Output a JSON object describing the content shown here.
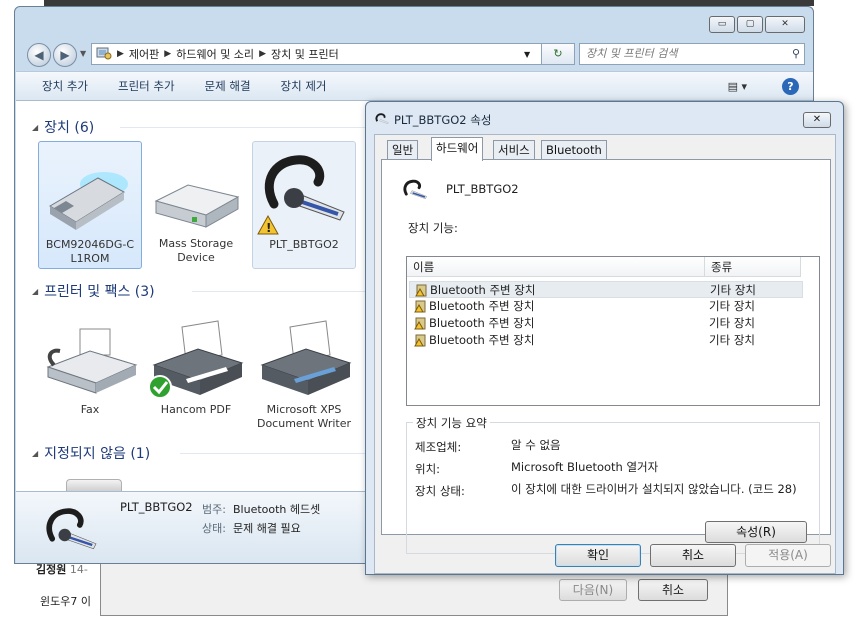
{
  "background_window": {
    "next_label": "다음(N)",
    "cancel_label": "취소",
    "text_partial_1": "김정원",
    "text_partial_1b": "14-",
    "text_partial_2": "윈도우7 이"
  },
  "explorer": {
    "window_buttons": {
      "minimize": "▭",
      "maximize": "▢",
      "close": "✕"
    },
    "breadcrumb": [
      "제어판",
      "하드웨어 및 소리",
      "장치 및 프린터"
    ],
    "search_placeholder": "장치 및 프린터 검색",
    "command_bar": [
      "장치 추가",
      "프린터 추가",
      "문제 해결",
      "장치 제거"
    ],
    "help_label": "?",
    "groups": {
      "devices": "장치 (6)",
      "printers": "프린터 및 팩스 (3)",
      "unspecified": "지정되지 않음 (1)"
    },
    "devices": [
      {
        "label": "BCM92046DG-C\nL1ROM",
        "icon": "usb-dongle-icon"
      },
      {
        "label": "Mass Storage\nDevice",
        "icon": "storage-drive-icon"
      },
      {
        "label": "PLT_BBTGO2",
        "icon": "headset-icon",
        "warning": true
      }
    ],
    "printers": [
      {
        "label": "Fax",
        "icon": "fax-icon"
      },
      {
        "label": "Hancom PDF",
        "icon": "printer-icon",
        "default": true
      },
      {
        "label": "Microsoft XPS\nDocument Writer",
        "icon": "printer-icon"
      }
    ],
    "details": {
      "name": "PLT_BBTGO2",
      "category_label": "범주:",
      "category_value": "Bluetooth 헤드셋",
      "status_label": "상태:",
      "status_value": "문제 해결 필요"
    }
  },
  "dialog": {
    "title": "PLT_BBTGO2 속성",
    "close_label": "✕",
    "tabs": [
      "일반",
      "하드웨어",
      "서비스",
      "Bluetooth"
    ],
    "active_tab": 1,
    "device_name": "PLT_BBTGO2",
    "functions_label": "장치 기능:",
    "list_headers": [
      "이름",
      "종류"
    ],
    "list_rows": [
      {
        "name": "Bluetooth 주변 장치",
        "type": "기타 장치"
      },
      {
        "name": "Bluetooth 주변 장치",
        "type": "기타 장치"
      },
      {
        "name": "Bluetooth 주변 장치",
        "type": "기타 장치"
      },
      {
        "name": "Bluetooth 주변 장치",
        "type": "기타 장치"
      }
    ],
    "summary_title": "장치 기능 요약",
    "manufacturer_label": "제조업체:",
    "manufacturer_value": "알 수 없음",
    "location_label": "위치:",
    "location_value": "Microsoft Bluetooth 열거자",
    "status_label": "장치 상태:",
    "status_value": "이 장치에 대한 드라이버가 설치되지 않았습니다. (코드 28)",
    "properties_button": "속성(R)",
    "ok_button": "확인",
    "cancel_button": "취소",
    "apply_button": "적용(A)"
  }
}
